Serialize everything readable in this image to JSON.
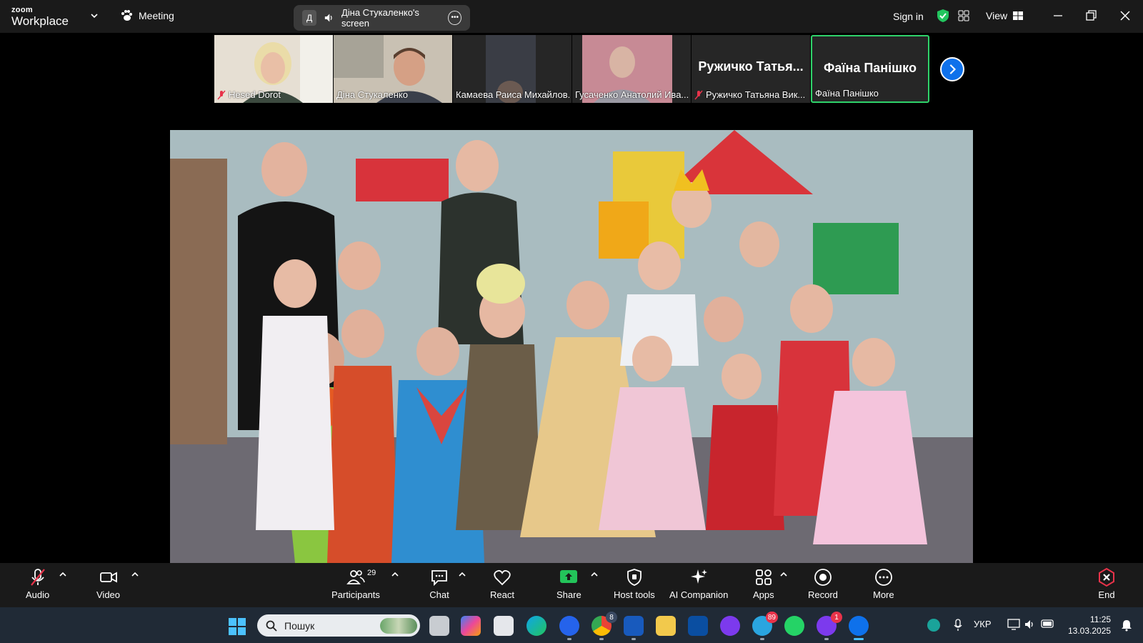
{
  "app": {
    "logo_top": "zoom",
    "logo_bottom": "Workplace",
    "meeting_label": "Meeting",
    "share_pill": {
      "initial": "Д",
      "label": "Діна Стукаленко's screen"
    },
    "sign_in": "Sign in",
    "view_label": "View"
  },
  "participants": [
    {
      "name": "Hesed Dorot",
      "muted": true
    },
    {
      "name": "Діна Стукаленко",
      "muted": false
    },
    {
      "name": "Камаева Раиса Михайлов...",
      "muted": false
    },
    {
      "name": "Гусаченко Анатолий Ива...",
      "muted": false
    },
    {
      "name": "Ружичко Татьяна Вик...",
      "big_label": "Ружичко Татья...",
      "muted": true
    },
    {
      "name": "Фаїна Панішко",
      "big_label": "Фаїна Панішко",
      "muted": false,
      "active": true
    }
  ],
  "toolbar": {
    "audio": "Audio",
    "video": "Video",
    "participants": "Participants",
    "participants_count": "29",
    "chat": "Chat",
    "react": "React",
    "share": "Share",
    "host_tools": "Host tools",
    "ai_companion": "AI Companion",
    "apps": "Apps",
    "record": "Record",
    "more": "More",
    "end": "End"
  },
  "taskbar": {
    "search_placeholder": "Пошук",
    "chrome_badge": "8",
    "telegram_badge": "89",
    "viber_badge": "1",
    "language": "УКР",
    "time": "11:25",
    "date": "13.03.2025"
  },
  "colors": {
    "zoom_blue": "#0e71eb",
    "active_green": "#2fd36a",
    "share_green": "#23c45a",
    "end_red": "#e8334a"
  }
}
